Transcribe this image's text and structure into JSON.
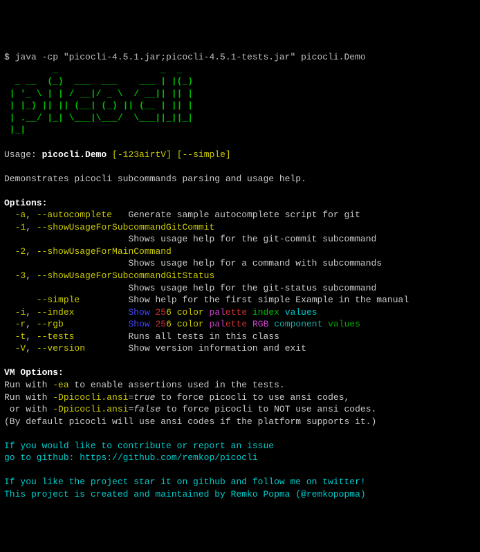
{
  "prompt": "$ ",
  "command": "java -cp \"picocli-4.5.1.jar;picocli-4.5.1-tests.jar\" picocli.Demo",
  "ascii_art": [
    "         _                   _  _",
    "  _ __  (_)  ___  ___    ___ | |(_)",
    " | '_ \\ | | / __|/ _ \\  / __|| || |",
    " | |_) || || (__| (_) || (__ | || |",
    " | .__/ |_| \\___|\\___/  \\___||_||_|",
    " |_|"
  ],
  "usage_label": "Usage: ",
  "usage_cmd": "picocli.Demo",
  "usage_opts1": "[-123airtV]",
  "usage_opts2": "[--simple]",
  "description": "Demonstrates picocli subcommands parsing and usage help.",
  "options_header": "Options:",
  "opts": {
    "a": {
      "short": "-a",
      "long": "--autocomplete",
      "desc": "Generate sample autocomplete script for git"
    },
    "one": {
      "short": "-1",
      "long": "--showUsageForSubcommandGitCommit",
      "desc": "Shows usage help for the git-commit subcommand"
    },
    "two": {
      "short": "-2",
      "long": "--showUsageForMainCommand",
      "desc": "Shows usage help for a command with subcommands"
    },
    "three": {
      "short": "-3",
      "long": "--showUsageForSubcommandGitStatus",
      "desc": "Shows usage help for the git-status subcommand"
    },
    "simple": {
      "long": "--simple",
      "desc": "Show help for the first simple Example in the manual"
    },
    "i": {
      "short": "-i",
      "long": "--index"
    },
    "r": {
      "short": "-r",
      "long": "--rgb"
    },
    "t": {
      "short": "-t",
      "long": "--tests",
      "desc": "Runs all tests in this class"
    },
    "v": {
      "short": "-V",
      "long": "--version",
      "desc": "Show version information and exit"
    }
  },
  "show_parts": {
    "p1": "Show",
    "p2": "25",
    "p3": "6 color",
    "p4": "pal",
    "p5": "ette",
    "idx": "index",
    "rgb1": "RGB",
    "rgb2": "component",
    "val_i": "values",
    "val_r": "values"
  },
  "vm_header": "VM Options:",
  "vm_line1_a": "Run with ",
  "vm_line1_b": "-ea",
  "vm_line1_c": " to enable assertions used in the tests.",
  "vm_line2_a": "Run with ",
  "vm_line2_b": "-Dpicocli.ansi",
  "vm_line2_c": "=",
  "vm_line2_d": "true",
  "vm_line2_e": " to force picocli to use ansi codes,",
  "vm_line3_a": " or with ",
  "vm_line3_b": "-Dpicocli.ansi",
  "vm_line3_c": "=",
  "vm_line3_d": "false",
  "vm_line3_e": " to force picocli to NOT use ansi codes.",
  "vm_line4": "(By default picocli will use ansi codes if the platform supports it.)",
  "footer_line1": "If you would like to contribute or report an issue",
  "footer_line2a": "go to github: ",
  "footer_url": "https://github.com/remkop/picocli",
  "footer_line3": "If you like the project star it on github and follow me on twitter!",
  "footer_line4": "This project is created and maintained by Remko Popma (@remkopopma)"
}
